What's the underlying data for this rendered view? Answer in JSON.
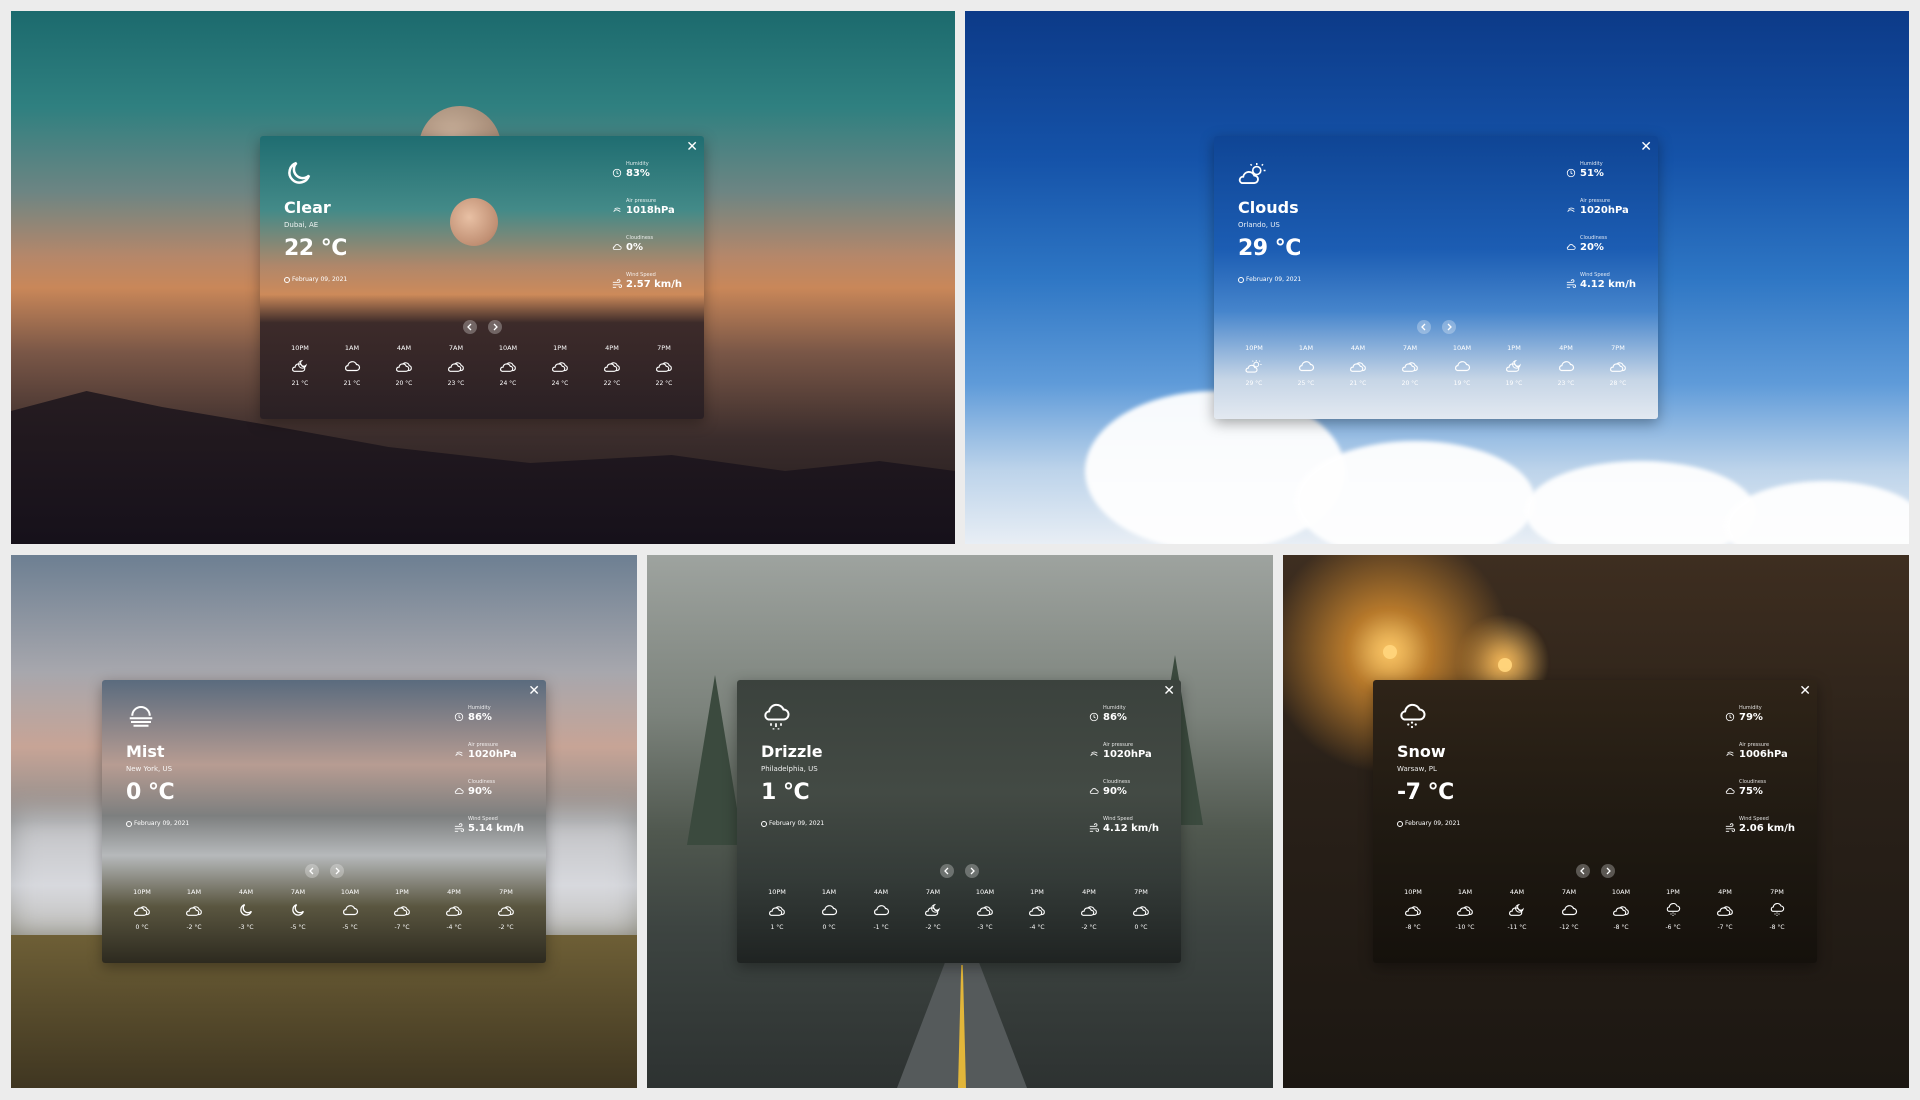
{
  "cards": [
    {
      "condition": "Clear",
      "location": "Dubai, AE",
      "temp": "22 °C",
      "date": "February 09, 2021",
      "icon": "moon-icon",
      "stats": [
        {
          "label": "Humidity",
          "value": "83%",
          "icon": "humidity-icon"
        },
        {
          "label": "Air pressure",
          "value": "1018hPa",
          "icon": "pressure-icon"
        },
        {
          "label": "Cloudiness",
          "value": "0%",
          "icon": "cloudiness-icon"
        },
        {
          "label": "Wind Speed",
          "value": "2.57 km/h",
          "icon": "wind-icon"
        }
      ],
      "hourly": [
        {
          "time": "10PM",
          "icon": "cloud-moon-icon",
          "temp": "21 °C"
        },
        {
          "time": "1AM",
          "icon": "cloud-icon",
          "temp": "21 °C"
        },
        {
          "time": "4AM",
          "icon": "clouds-icon",
          "temp": "20 °C"
        },
        {
          "time": "7AM",
          "icon": "clouds-icon",
          "temp": "23 °C"
        },
        {
          "time": "10AM",
          "icon": "clouds-icon",
          "temp": "24 °C"
        },
        {
          "time": "1PM",
          "icon": "clouds-icon",
          "temp": "24 °C"
        },
        {
          "time": "4PM",
          "icon": "clouds-icon",
          "temp": "22 °C"
        },
        {
          "time": "7PM",
          "icon": "clouds-icon",
          "temp": "22 °C"
        }
      ]
    },
    {
      "condition": "Clouds",
      "location": "Orlando, US",
      "temp": "29 °C",
      "date": "February 09, 2021",
      "icon": "cloud-sun-icon",
      "stats": [
        {
          "label": "Humidity",
          "value": "51%",
          "icon": "humidity-icon"
        },
        {
          "label": "Air pressure",
          "value": "1020hPa",
          "icon": "pressure-icon"
        },
        {
          "label": "Cloudiness",
          "value": "20%",
          "icon": "cloudiness-icon"
        },
        {
          "label": "Wind Speed",
          "value": "4.12 km/h",
          "icon": "wind-icon"
        }
      ],
      "hourly": [
        {
          "time": "10PM",
          "icon": "cloud-sun-icon",
          "temp": "29 °C"
        },
        {
          "time": "1AM",
          "icon": "cloud-icon",
          "temp": "25 °C"
        },
        {
          "time": "4AM",
          "icon": "clouds-icon",
          "temp": "21 °C"
        },
        {
          "time": "7AM",
          "icon": "clouds-icon",
          "temp": "20 °C"
        },
        {
          "time": "10AM",
          "icon": "cloud-icon",
          "temp": "19 °C"
        },
        {
          "time": "1PM",
          "icon": "cloud-moon-icon",
          "temp": "19 °C"
        },
        {
          "time": "4PM",
          "icon": "cloud-icon",
          "temp": "23 °C"
        },
        {
          "time": "7PM",
          "icon": "clouds-icon",
          "temp": "28 °C"
        }
      ]
    },
    {
      "condition": "Mist",
      "location": "New York, US",
      "temp": "0 °C",
      "date": "February 09, 2021",
      "icon": "mist-icon",
      "stats": [
        {
          "label": "Humidity",
          "value": "86%",
          "icon": "humidity-icon"
        },
        {
          "label": "Air pressure",
          "value": "1020hPa",
          "icon": "pressure-icon"
        },
        {
          "label": "Cloudiness",
          "value": "90%",
          "icon": "cloudiness-icon"
        },
        {
          "label": "Wind Speed",
          "value": "5.14 km/h",
          "icon": "wind-icon"
        }
      ],
      "hourly": [
        {
          "time": "10PM",
          "icon": "clouds-icon",
          "temp": "0 °C"
        },
        {
          "time": "1AM",
          "icon": "clouds-icon",
          "temp": "-2 °C"
        },
        {
          "time": "4AM",
          "icon": "moon-icon",
          "temp": "-3 °C"
        },
        {
          "time": "7AM",
          "icon": "moon-icon",
          "temp": "-5 °C"
        },
        {
          "time": "10AM",
          "icon": "cloud-icon",
          "temp": "-5 °C"
        },
        {
          "time": "1PM",
          "icon": "clouds-icon",
          "temp": "-7 °C"
        },
        {
          "time": "4PM",
          "icon": "clouds-icon",
          "temp": "-4 °C"
        },
        {
          "time": "7PM",
          "icon": "clouds-icon",
          "temp": "-2 °C"
        }
      ]
    },
    {
      "condition": "Drizzle",
      "location": "Philadelphia, US",
      "temp": "1 °C",
      "date": "February 09, 2021",
      "icon": "drizzle-icon",
      "stats": [
        {
          "label": "Humidity",
          "value": "86%",
          "icon": "humidity-icon"
        },
        {
          "label": "Air pressure",
          "value": "1020hPa",
          "icon": "pressure-icon"
        },
        {
          "label": "Cloudiness",
          "value": "90%",
          "icon": "cloudiness-icon"
        },
        {
          "label": "Wind Speed",
          "value": "4.12 km/h",
          "icon": "wind-icon"
        }
      ],
      "hourly": [
        {
          "time": "10PM",
          "icon": "clouds-icon",
          "temp": "1 °C"
        },
        {
          "time": "1AM",
          "icon": "cloud-icon",
          "temp": "0 °C"
        },
        {
          "time": "4AM",
          "icon": "cloud-icon",
          "temp": "-1 °C"
        },
        {
          "time": "7AM",
          "icon": "cloud-moon-icon",
          "temp": "-2 °C"
        },
        {
          "time": "10AM",
          "icon": "clouds-icon",
          "temp": "-3 °C"
        },
        {
          "time": "1PM",
          "icon": "clouds-icon",
          "temp": "-4 °C"
        },
        {
          "time": "4PM",
          "icon": "clouds-icon",
          "temp": "-2 °C"
        },
        {
          "time": "7PM",
          "icon": "clouds-icon",
          "temp": "0 °C"
        }
      ]
    },
    {
      "condition": "Snow",
      "location": "Warsaw, PL",
      "temp": "-7 °C",
      "date": "February 09, 2021",
      "icon": "snow-icon",
      "stats": [
        {
          "label": "Humidity",
          "value": "79%",
          "icon": "humidity-icon"
        },
        {
          "label": "Air pressure",
          "value": "1006hPa",
          "icon": "pressure-icon"
        },
        {
          "label": "Cloudiness",
          "value": "75%",
          "icon": "cloudiness-icon"
        },
        {
          "label": "Wind Speed",
          "value": "2.06 km/h",
          "icon": "wind-icon"
        }
      ],
      "hourly": [
        {
          "time": "10PM",
          "icon": "clouds-icon",
          "temp": "-8 °C"
        },
        {
          "time": "1AM",
          "icon": "clouds-icon",
          "temp": "-10 °C"
        },
        {
          "time": "4AM",
          "icon": "cloud-moon-icon",
          "temp": "-11 °C"
        },
        {
          "time": "7AM",
          "icon": "cloud-icon",
          "temp": "-12 °C"
        },
        {
          "time": "10AM",
          "icon": "clouds-icon",
          "temp": "-8 °C"
        },
        {
          "time": "1PM",
          "icon": "snow-icon",
          "temp": "-6 °C"
        },
        {
          "time": "4PM",
          "icon": "clouds-icon",
          "temp": "-7 °C"
        },
        {
          "time": "7PM",
          "icon": "snow-icon",
          "temp": "-8 °C"
        }
      ]
    }
  ]
}
